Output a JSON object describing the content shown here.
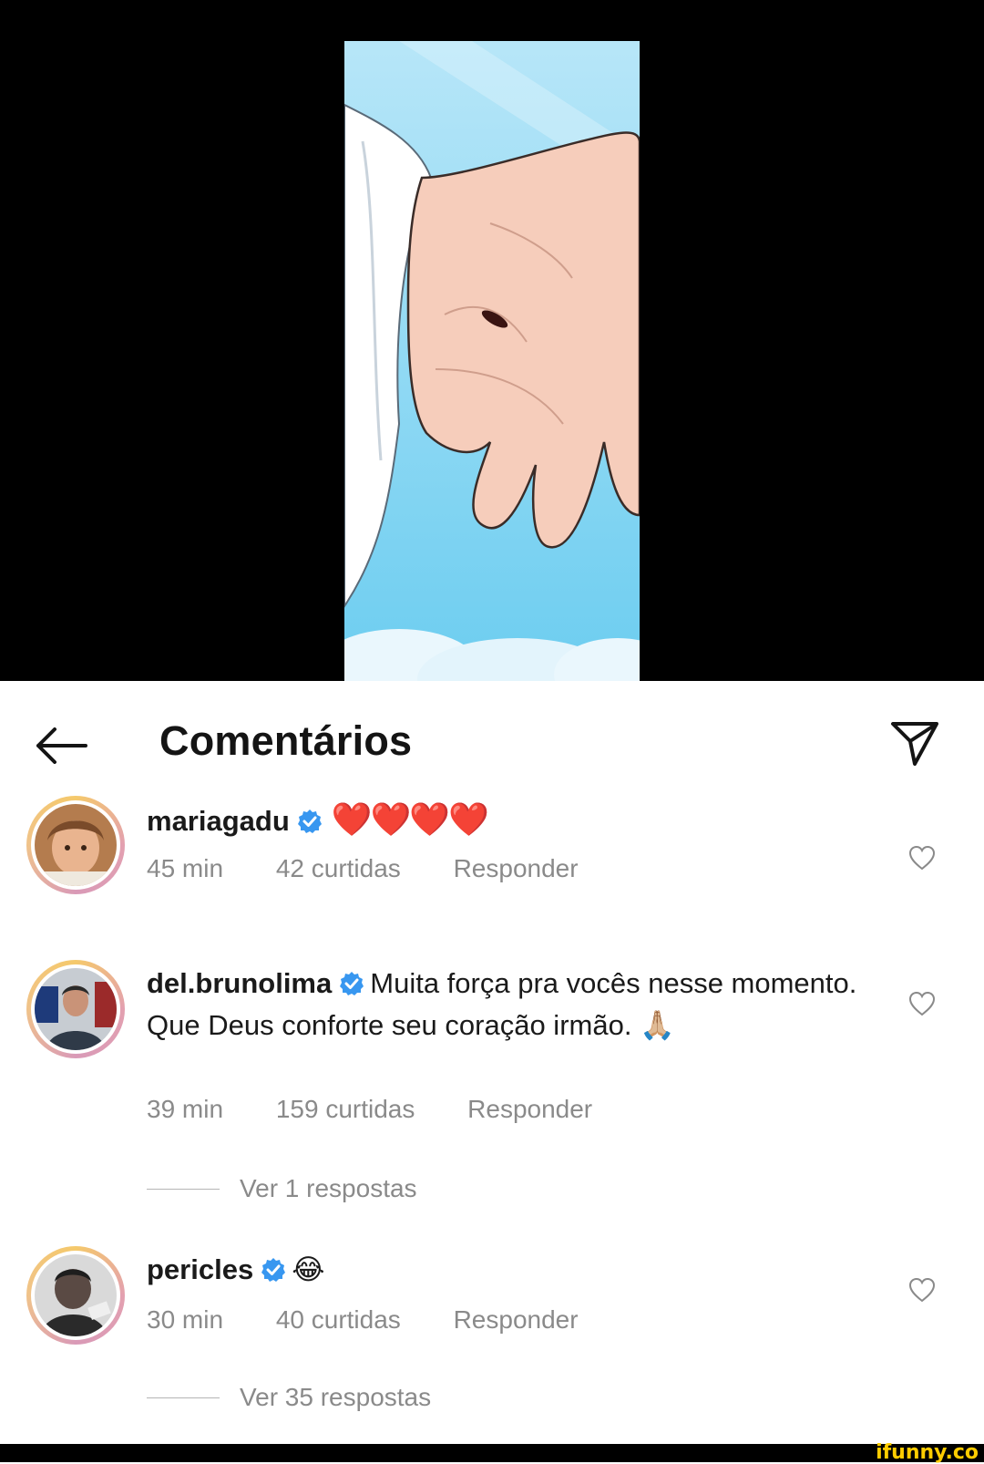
{
  "header": {
    "title": "Comentários"
  },
  "comments": [
    {
      "username": "mariagadu",
      "text": "❤️❤️❤️❤️",
      "time": "45 min",
      "likes": "42 curtidas",
      "reply": "Responder"
    },
    {
      "username": "del.brunolima",
      "text": "Muita força pra vocês nesse momento. Que Deus conforte seu coração irmão. 🙏🏼",
      "time": "39 min",
      "likes": "159 curtidas",
      "reply": "Responder",
      "view_replies": "Ver 1 respostas"
    },
    {
      "username": "pericles",
      "text": "😂",
      "time": "30 min",
      "likes": "40 curtidas",
      "reply": "Responder",
      "view_replies": "Ver 35 respostas"
    }
  ],
  "watermark": "ifunny.co",
  "colors": {
    "verified": "#3897f0",
    "heart": "#d61f26",
    "meta_text": "#8a8a8a",
    "sky": "#8fd7f3"
  },
  "icons": [
    "back-arrow-icon",
    "send-icon",
    "verified-badge-icon",
    "like-heart-icon"
  ]
}
